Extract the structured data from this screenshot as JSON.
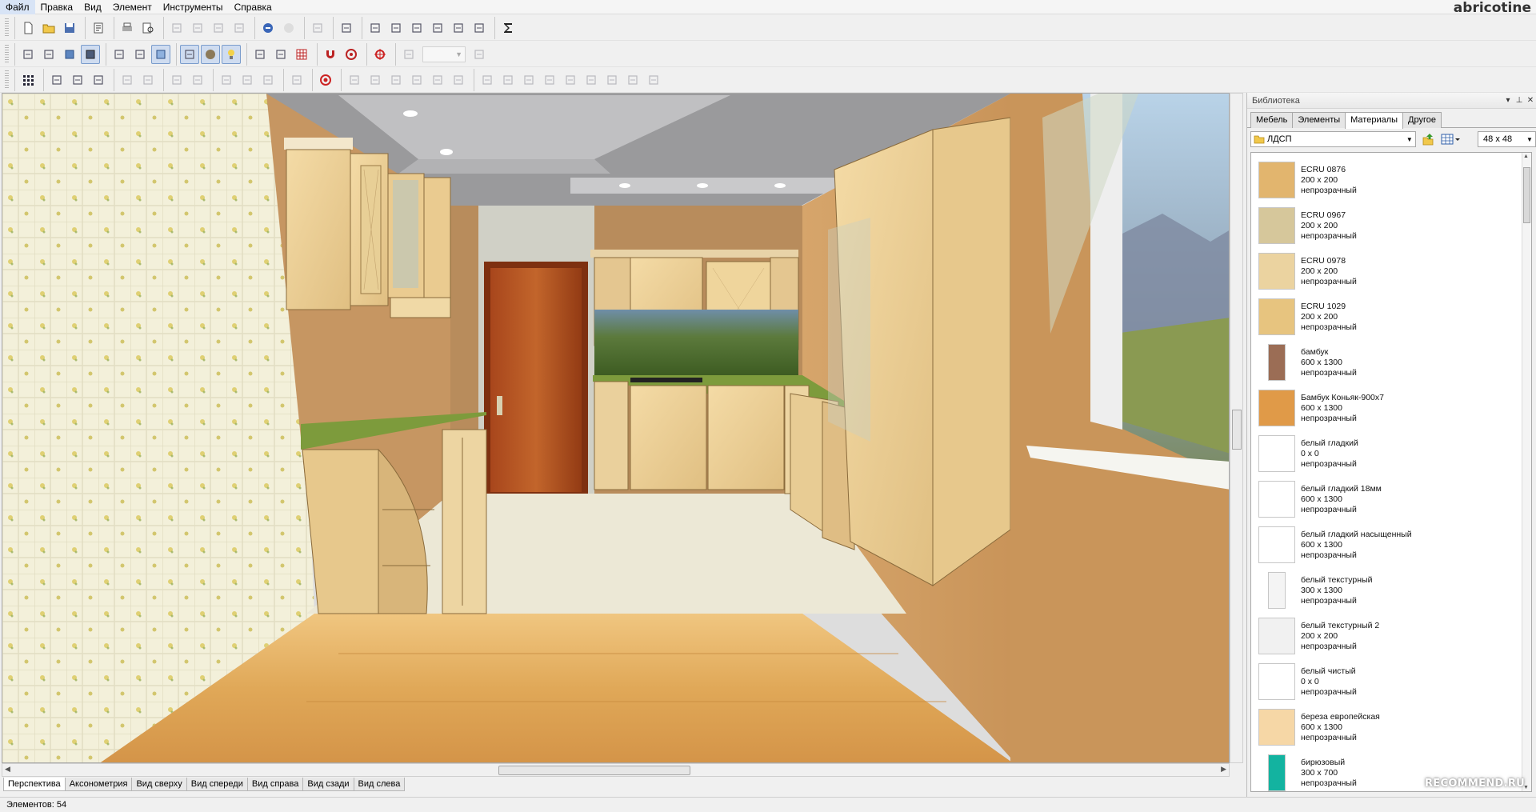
{
  "menu": [
    "Файл",
    "Правка",
    "Вид",
    "Элемент",
    "Инструменты",
    "Справка"
  ],
  "watermark_user": "abricotine",
  "toolbar1": {
    "groups": [
      [
        "new-file-icon",
        "open-folder-icon",
        "save-icon"
      ],
      [
        "properties-icon"
      ],
      [
        "print-icon",
        "print-preview-icon"
      ],
      [
        "cut-icon",
        "copy-icon",
        "paste-icon",
        "delete-icon"
      ],
      [
        "undo-icon",
        "redo-icon"
      ],
      [
        "help-icon"
      ],
      [
        "checklist-icon"
      ],
      [
        "layout-icon",
        "zoom-doc-icon",
        "doc-settings-icon",
        "dimensions-icon",
        "monitor-icon",
        "render-icon"
      ],
      [
        "sum-icon"
      ]
    ]
  },
  "toolbar2": {
    "groups": [
      [
        "wall-icon",
        "box-icon",
        "cube-blue-icon",
        "cube-dark-icon"
      ],
      [
        "frame-icon",
        "frame-open-icon",
        "cube-light-icon"
      ],
      [
        "text-label-icon",
        "sphere-icon",
        "bulb-icon"
      ],
      [
        "rotate-icon",
        "measure-icon",
        "grid-icon"
      ],
      [
        "magnet-icon",
        "target-icon"
      ],
      [
        "crosshair-icon"
      ],
      [
        "zoom-in-icon",
        "zoom-combo",
        "zoom-out-icon"
      ]
    ]
  },
  "toolbar3": {
    "groups": [
      [
        "select-grid-icon"
      ],
      [
        "move-up-icon",
        "move-icon",
        "pen-icon"
      ],
      [
        "group-icon",
        "ungroup-icon"
      ],
      [
        "align-left-icon",
        "align-right-icon"
      ],
      [
        "rotate-left-icon",
        "plus-move-icon",
        "warning-icon"
      ],
      [
        "mirror-icon"
      ],
      [
        "record-icon"
      ],
      [
        "align-bottom-icon",
        "align-center-icon",
        "align-top-icon",
        "distribute-h-icon",
        "distribute-v-icon",
        "arrange-icon"
      ],
      [
        "equal-left-icon",
        "equal-center-icon",
        "equal-right-icon",
        "equal-width-icon",
        "equal-height-icon",
        "chart-icon",
        "chat-icon",
        "flip-icon",
        "lock-icon"
      ]
    ]
  },
  "view_tabs": [
    "Перспектива",
    "Аксонометрия",
    "Вид сверху",
    "Вид спереди",
    "Вид справа",
    "Вид сзади",
    "Вид слева"
  ],
  "active_view_tab": 0,
  "status": {
    "elements": "Элементов: 54"
  },
  "library": {
    "title": "Библиотека",
    "tabs": [
      "Мебель",
      "Элементы",
      "Материалы",
      "Другое"
    ],
    "active_tab": 2,
    "folder": "ЛДСП",
    "thumb_size": "48 x 48",
    "materials": [
      {
        "name": "ECRU 0876",
        "size": "200 x 200",
        "opacity": "непрозрачный",
        "color": "#e2b56e",
        "narrow": false
      },
      {
        "name": "ECRU 0967",
        "size": "200 x 200",
        "opacity": "непрозрачный",
        "color": "#d6c79b",
        "narrow": false
      },
      {
        "name": "ECRU 0978",
        "size": "200 x 200",
        "opacity": "непрозрачный",
        "color": "#ebd3a0",
        "narrow": false
      },
      {
        "name": "ECRU 1029",
        "size": "200 x 200",
        "opacity": "непрозрачный",
        "color": "#e7c47f",
        "narrow": false
      },
      {
        "name": "бамбук",
        "size": "600 x 1300",
        "opacity": "непрозрачный",
        "color": "#9b6d55",
        "narrow": true
      },
      {
        "name": "Бамбук Коньяк-900х7",
        "size": "600 x 1300",
        "opacity": "непрозрачный",
        "color": "#e09a48",
        "narrow": false
      },
      {
        "name": "белый гладкий",
        "size": "0 x 0",
        "opacity": "непрозрачный",
        "color": "#ffffff",
        "narrow": false
      },
      {
        "name": "белый гладкий 18мм",
        "size": "600 x 1300",
        "opacity": "непрозрачный",
        "color": "#ffffff",
        "narrow": false
      },
      {
        "name": "белый гладкий насыщенный",
        "size": "600 x 1300",
        "opacity": "непрозрачный",
        "color": "#ffffff",
        "narrow": false
      },
      {
        "name": "белый текстурный",
        "size": "300 x 1300",
        "opacity": "непрозрачный",
        "color": "#f4f4f4",
        "narrow": true
      },
      {
        "name": "белый текстурный 2",
        "size": "200 x 200",
        "opacity": "непрозрачный",
        "color": "#f1f1f1",
        "narrow": false
      },
      {
        "name": "белый чистый",
        "size": "0 x 0",
        "opacity": "непрозрачный",
        "color": "#ffffff",
        "narrow": false
      },
      {
        "name": "береза европейская",
        "size": "600 x 1300",
        "opacity": "непрозрачный",
        "color": "#f6d7a6",
        "narrow": false
      },
      {
        "name": "бирюзовый",
        "size": "300 x 700",
        "opacity": "непрозрачный",
        "color": "#13b3a0",
        "narrow": true
      }
    ]
  },
  "recommend_watermark": "RECOMMEND.RU"
}
